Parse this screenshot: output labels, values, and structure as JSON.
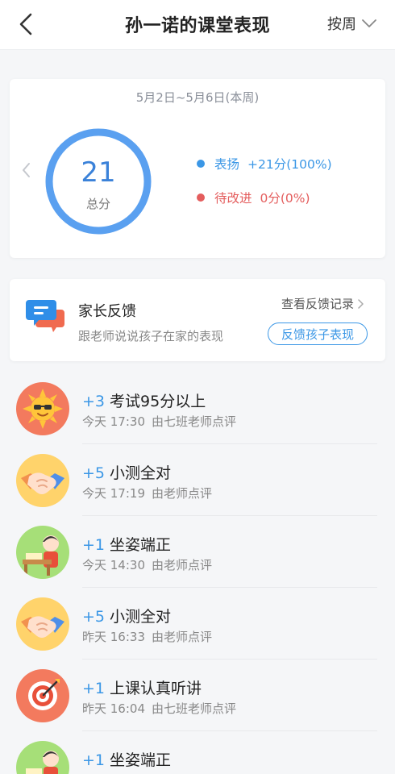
{
  "header": {
    "title": "孙一诺的课堂表现",
    "period": "按周"
  },
  "summary": {
    "date_range": "5月2日~5月6日(本周)",
    "score": "21",
    "score_label": "总分",
    "praise_fraction": 1.0,
    "praise": {
      "label": "表扬",
      "value": "+21分(100%)",
      "color": "#3b97e6"
    },
    "improve": {
      "label": "待改进",
      "value": "0分(0%)",
      "color": "#e45d5d"
    }
  },
  "feedback": {
    "title": "家长反馈",
    "subtitle": "跟老师说说孩子在家的表现",
    "history_link": "查看反馈记录",
    "button": "反馈孩子表现"
  },
  "records": [
    {
      "icon": "sun-sunglasses-icon",
      "points": "+3",
      "title": "考试95分以上",
      "time": "今天 17:30",
      "by": "由七班老师点评"
    },
    {
      "icon": "handshake-icon",
      "points": "+5",
      "title": "小测全对",
      "time": "今天 17:19",
      "by": "由老师点评"
    },
    {
      "icon": "sitting-student-icon",
      "points": "+1",
      "title": "坐姿端正",
      "time": "今天 14:30",
      "by": "由老师点评"
    },
    {
      "icon": "handshake-icon",
      "points": "+5",
      "title": "小测全对",
      "time": "昨天 16:33",
      "by": "由老师点评"
    },
    {
      "icon": "target-dart-icon",
      "points": "+1",
      "title": "上课认真听讲",
      "time": "昨天 16:04",
      "by": "由七班老师点评"
    },
    {
      "icon": "sitting-student-icon",
      "points": "+1",
      "title": "坐姿端正",
      "time": "",
      "by": ""
    }
  ]
}
